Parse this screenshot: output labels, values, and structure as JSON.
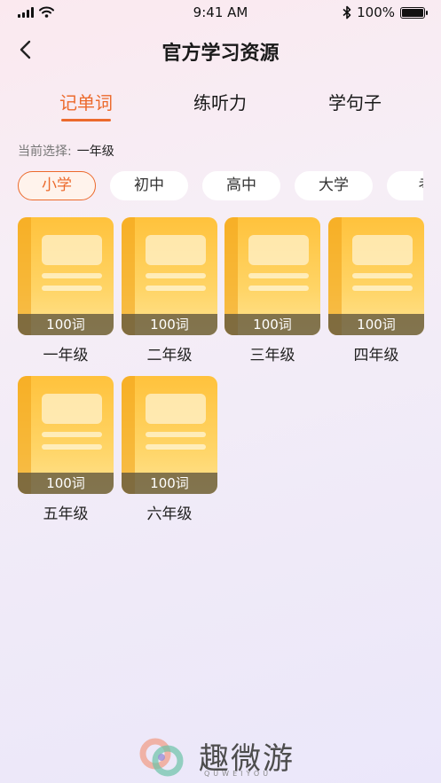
{
  "status_bar": {
    "time": "9:41 AM",
    "battery": "100%",
    "battery_level": 1.0
  },
  "header": {
    "title": "官方学习资源"
  },
  "tabs": [
    {
      "label": "记单词",
      "active": true
    },
    {
      "label": "练听力",
      "active": false
    },
    {
      "label": "学句子",
      "active": false
    }
  ],
  "current_selection": {
    "label": "当前选择:",
    "value": "一年级"
  },
  "levels": [
    {
      "label": "小学",
      "active": true
    },
    {
      "label": "初中",
      "active": false
    },
    {
      "label": "高中",
      "active": false
    },
    {
      "label": "大学",
      "active": false
    },
    {
      "label": "考",
      "active": false
    }
  ],
  "books": [
    {
      "count": "100词",
      "label": "一年级"
    },
    {
      "count": "100词",
      "label": "二年级"
    },
    {
      "count": "100词",
      "label": "三年级"
    },
    {
      "count": "100词",
      "label": "四年级"
    },
    {
      "count": "100词",
      "label": "五年级"
    },
    {
      "count": "100词",
      "label": "六年级"
    }
  ],
  "footer": {
    "brand": "趣微游",
    "brand_sub": "QUWEIYOU"
  },
  "colors": {
    "accent": "#ec6a2c",
    "book": "#ffc23c"
  }
}
